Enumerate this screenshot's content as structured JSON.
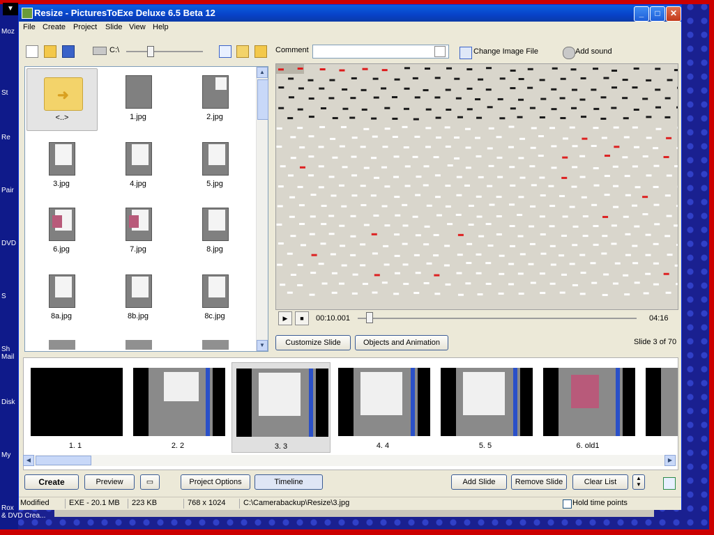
{
  "window": {
    "title": "Resize - PicturesToExe Deluxe 6.5 Beta 12"
  },
  "menu": [
    "File",
    "Create",
    "Project",
    "Slide",
    "View",
    "Help"
  ],
  "toolbar": {
    "drive": "C:\\",
    "comment_label": "Comment",
    "comment_value": "",
    "change_image_label": "Change Image File",
    "add_sound_label": "Add sound"
  },
  "browser": {
    "items": [
      "<..>",
      "1.jpg",
      "2.jpg",
      "3.jpg",
      "4.jpg",
      "5.jpg",
      "6.jpg",
      "7.jpg",
      "8.jpg",
      "8a.jpg",
      "8b.jpg",
      "8c.jpg"
    ]
  },
  "player": {
    "time": "00:10.001",
    "duration": "04:16",
    "slider_fraction": 0.04
  },
  "slide_buttons": {
    "customize": "Customize Slide",
    "objects": "Objects and Animation",
    "counter": "Slide 3 of 70"
  },
  "slides": [
    {
      "label": "1. 1"
    },
    {
      "label": "2. 2"
    },
    {
      "label": "3. 3"
    },
    {
      "label": "4. 4"
    },
    {
      "label": "5. 5"
    },
    {
      "label": "6. old1"
    },
    {
      "label": ""
    }
  ],
  "bottom": {
    "create": "Create",
    "preview": "Preview",
    "project_options": "Project Options",
    "timeline": "Timeline",
    "add_slide": "Add Slide",
    "remove_slide": "Remove Slide",
    "clear_list": "Clear List"
  },
  "status": {
    "modified": "Modified",
    "exe": "EXE - 20.1 MB",
    "size": "223 KB",
    "dims": "768 x 1024",
    "path": "C:\\Camerabackup\\Resize\\3.jpg",
    "hold": "Hold time points"
  },
  "desktop": {
    "labels": [
      "Moz",
      "St",
      "Re",
      "Pair",
      "DVD",
      "S",
      "Sh\nMail",
      "Disk",
      "My",
      "Rox\n& DVD Crea..."
    ]
  }
}
